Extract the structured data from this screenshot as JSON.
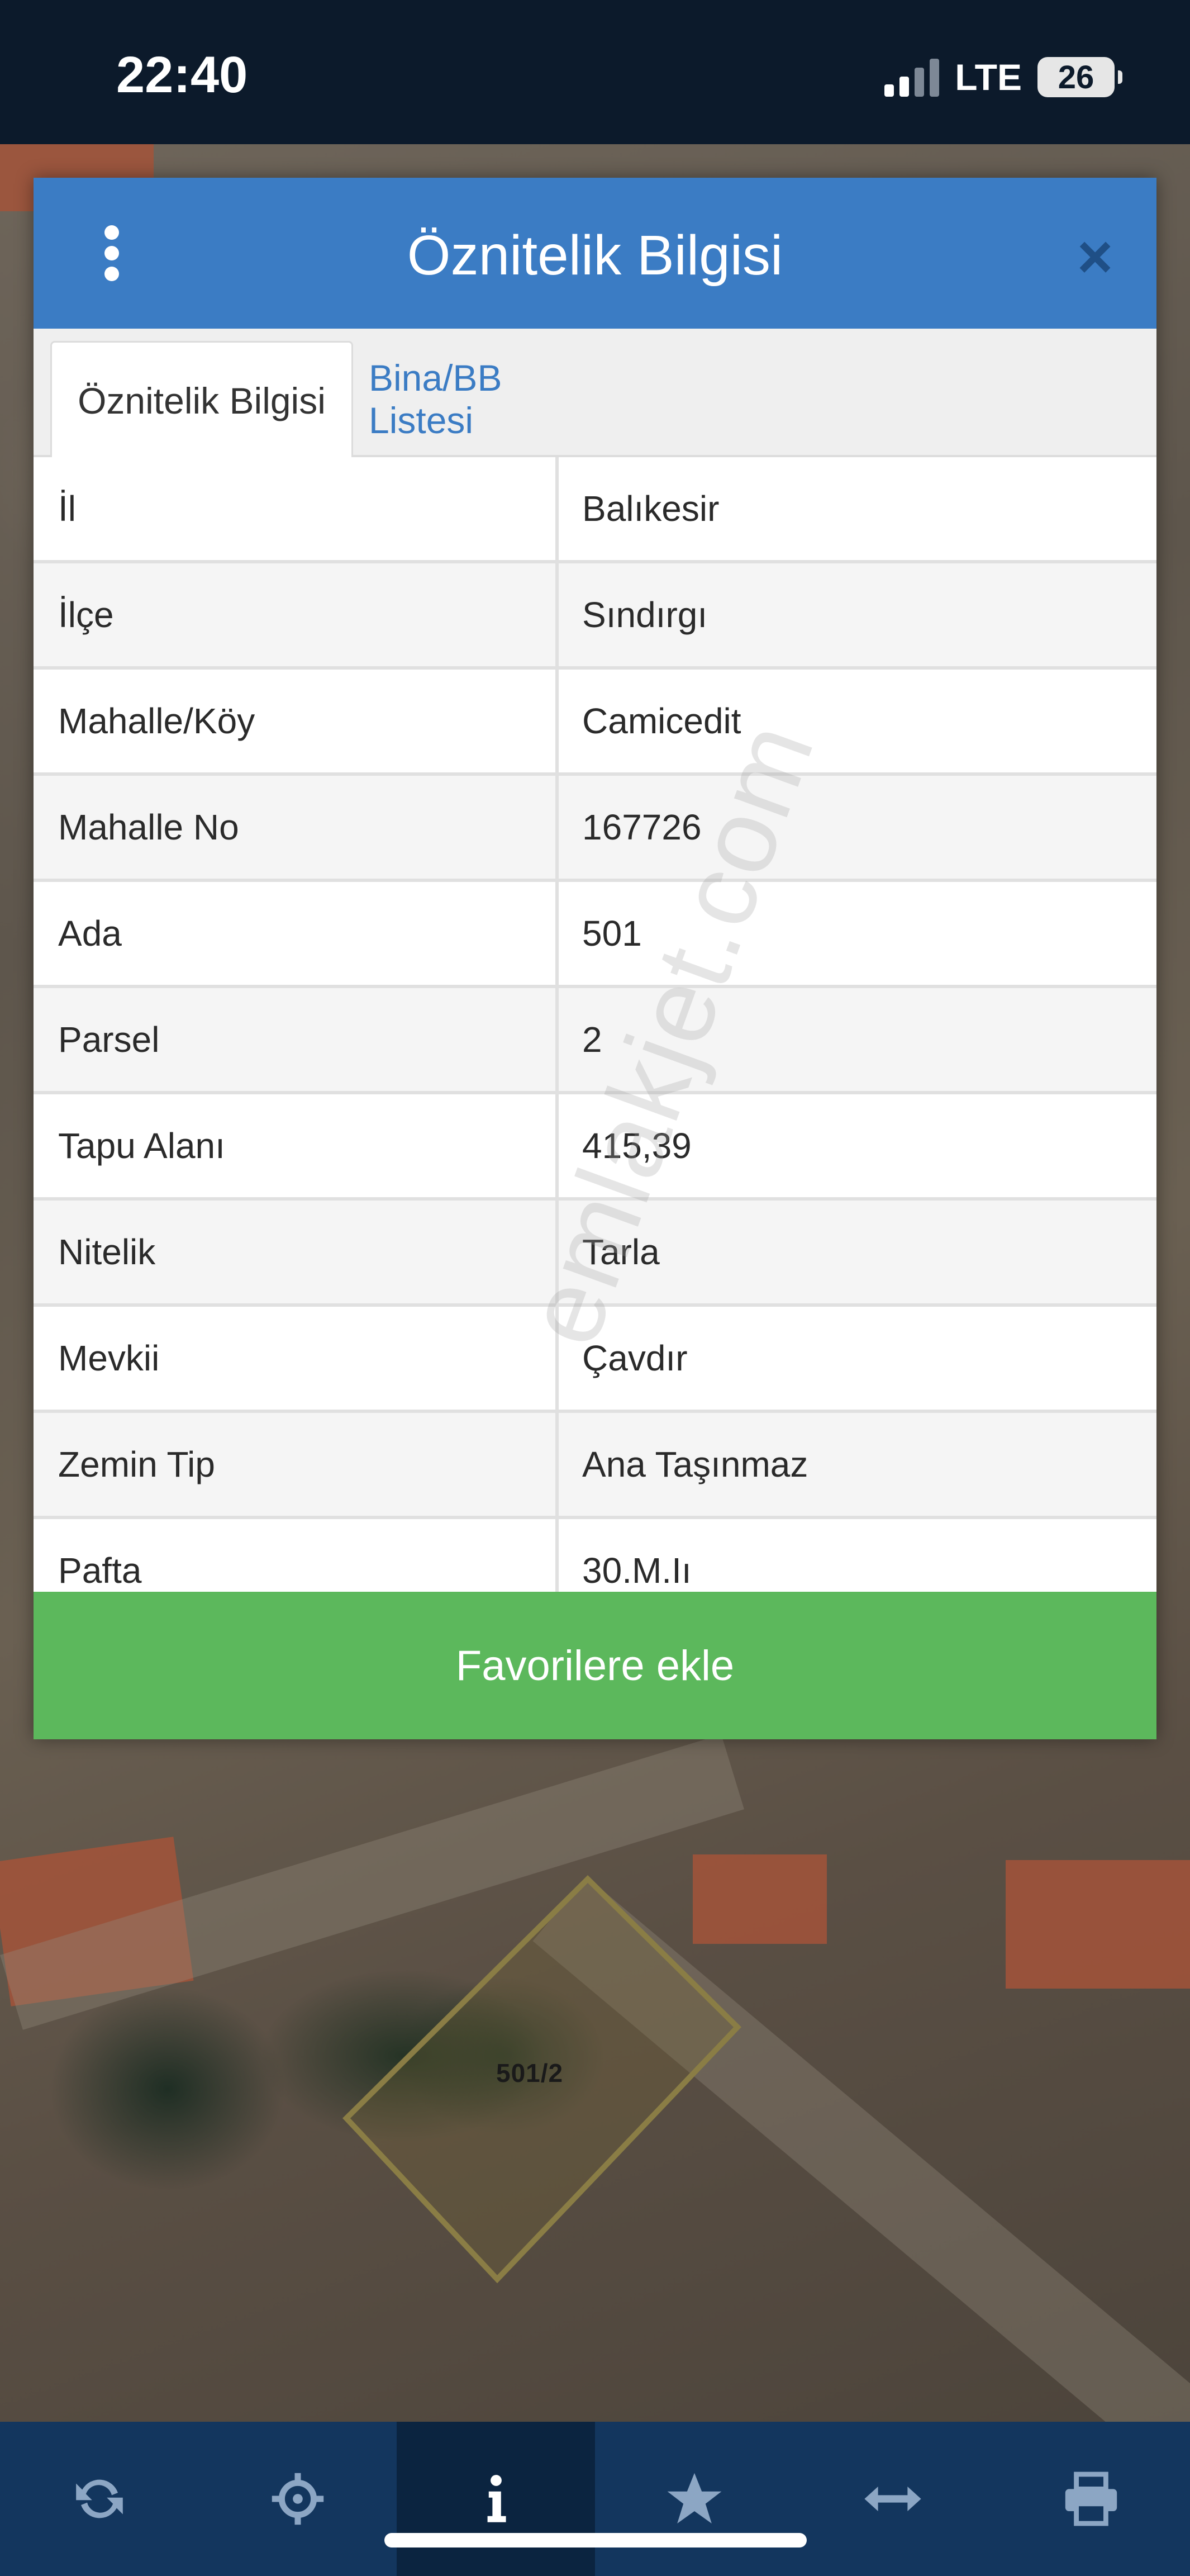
{
  "status_bar": {
    "time": "22:40",
    "network": "LTE",
    "battery": "26"
  },
  "map": {
    "parcel_label": "501/2"
  },
  "modal": {
    "title": "Öznitelik Bilgisi",
    "tabs": [
      {
        "label": "Öznitelik Bilgisi",
        "active": true
      },
      {
        "label": "Bina/BB Listesi",
        "active": false
      }
    ],
    "rows": [
      {
        "key": "İl",
        "value": "Balıkesir"
      },
      {
        "key": "İlçe",
        "value": "Sındırgı"
      },
      {
        "key": "Mahalle/Köy",
        "value": "Camicedit"
      },
      {
        "key": "Mahalle No",
        "value": "167726"
      },
      {
        "key": "Ada",
        "value": "501"
      },
      {
        "key": "Parsel",
        "value": "2"
      },
      {
        "key": "Tapu Alanı",
        "value": "415,39"
      },
      {
        "key": "Nitelik",
        "value": "Tarla"
      },
      {
        "key": "Mevkii",
        "value": "Çavdır"
      },
      {
        "key": "Zemin Tip",
        "value": "Ana Taşınmaz"
      },
      {
        "key": "Pafta",
        "value": "30.M.Iı"
      }
    ],
    "favorite_button": "Favorilere ekle",
    "watermark": "emlakjet.com"
  },
  "toolbar": {
    "items": [
      {
        "icon": "refresh-icon",
        "active": false
      },
      {
        "icon": "crosshair-icon",
        "active": false
      },
      {
        "icon": "info-icon",
        "active": true
      },
      {
        "icon": "star-icon",
        "active": false
      },
      {
        "icon": "measure-icon",
        "active": false
      },
      {
        "icon": "print-icon",
        "active": false
      }
    ]
  },
  "colors": {
    "header_blue": "#3b7cc4",
    "button_green": "#5cb85c",
    "toolbar_blue": "#13365e"
  }
}
